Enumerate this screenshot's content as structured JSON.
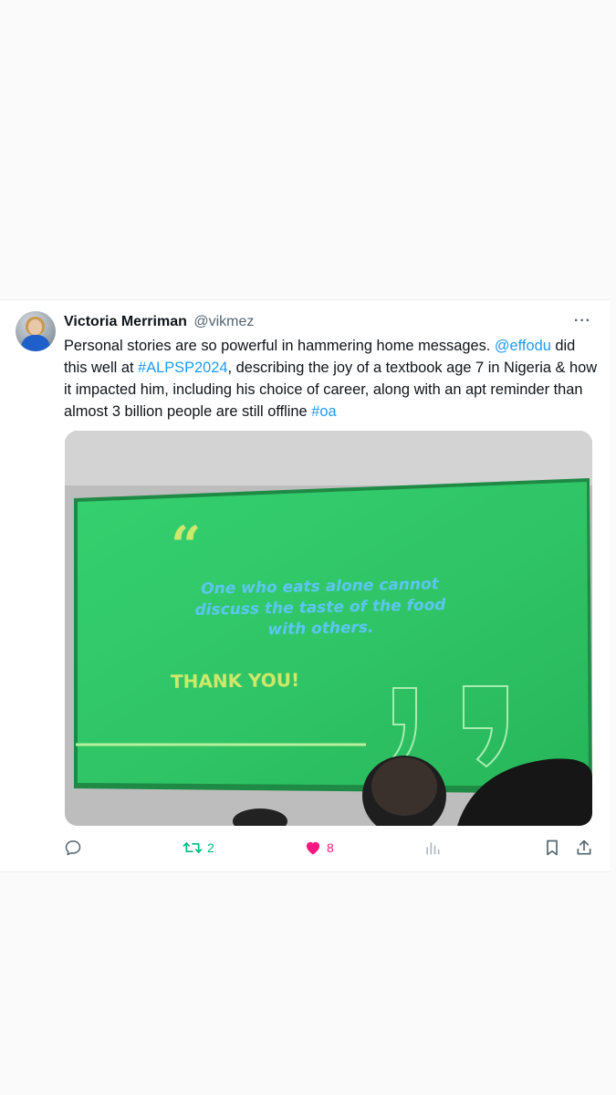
{
  "tweet": {
    "author_name": "Victoria Merriman",
    "author_handle": "@vikmez",
    "more_label": "···",
    "text_segments": [
      {
        "text": "Personal stories are so powerful in hammering home messages. ",
        "type": "plain"
      },
      {
        "text": "@effodu",
        "type": "link"
      },
      {
        "text": " did this well at ",
        "type": "plain"
      },
      {
        "text": "#ALPSP2024",
        "type": "link"
      },
      {
        "text": ", describing the joy of a textbook age 7 in Nigeria & how it impacted him, including his choice of career, along with an apt reminder than almost 3 billion people are still offline ",
        "type": "plain"
      },
      {
        "text": "#oa",
        "type": "link"
      }
    ],
    "link_color": "#1d9bf0"
  },
  "media": {
    "quote_open": "“",
    "quote_text": "One who eats alone cannot discuss the taste of the food with others.",
    "thank_you": "THANK YOU!",
    "slide_color": "#2fc466"
  },
  "actions": {
    "reply_icon": "reply-icon",
    "retweet_icon": "retweet-icon",
    "retweet_count": "2",
    "like_icon": "heart-icon",
    "like_count": "8",
    "views_icon": "views-icon",
    "bookmark_icon": "bookmark-icon",
    "share_icon": "share-icon",
    "retweet_color": "#00ba7c",
    "like_color": "#f91880"
  }
}
